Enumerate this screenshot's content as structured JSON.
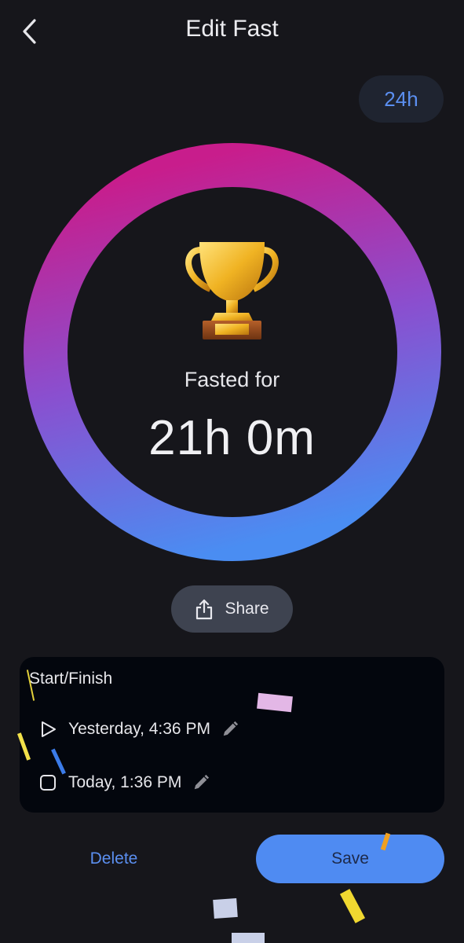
{
  "header": {
    "title": "Edit Fast"
  },
  "goal": {
    "label": "24h"
  },
  "ring": {
    "progress": 1.0,
    "gradient_colors": [
      "#c81d8c",
      "#8a4fcf",
      "#4a8df2"
    ]
  },
  "summary": {
    "label": "Fasted for",
    "value": "21h 0m"
  },
  "share": {
    "label": "Share"
  },
  "card": {
    "title": "Start/Finish",
    "start": {
      "value": "Yesterday, 4:36 PM"
    },
    "end": {
      "value": "Today, 1:36 PM"
    }
  },
  "actions": {
    "delete_label": "Delete",
    "save_label": "Save"
  },
  "colors": {
    "background": "#16161b",
    "accent": "#4f8bf2",
    "card": "#03060d"
  },
  "icons": [
    "chevron-left-icon",
    "trophy-icon",
    "share-icon",
    "play-icon",
    "stop-icon",
    "pencil-icon"
  ]
}
